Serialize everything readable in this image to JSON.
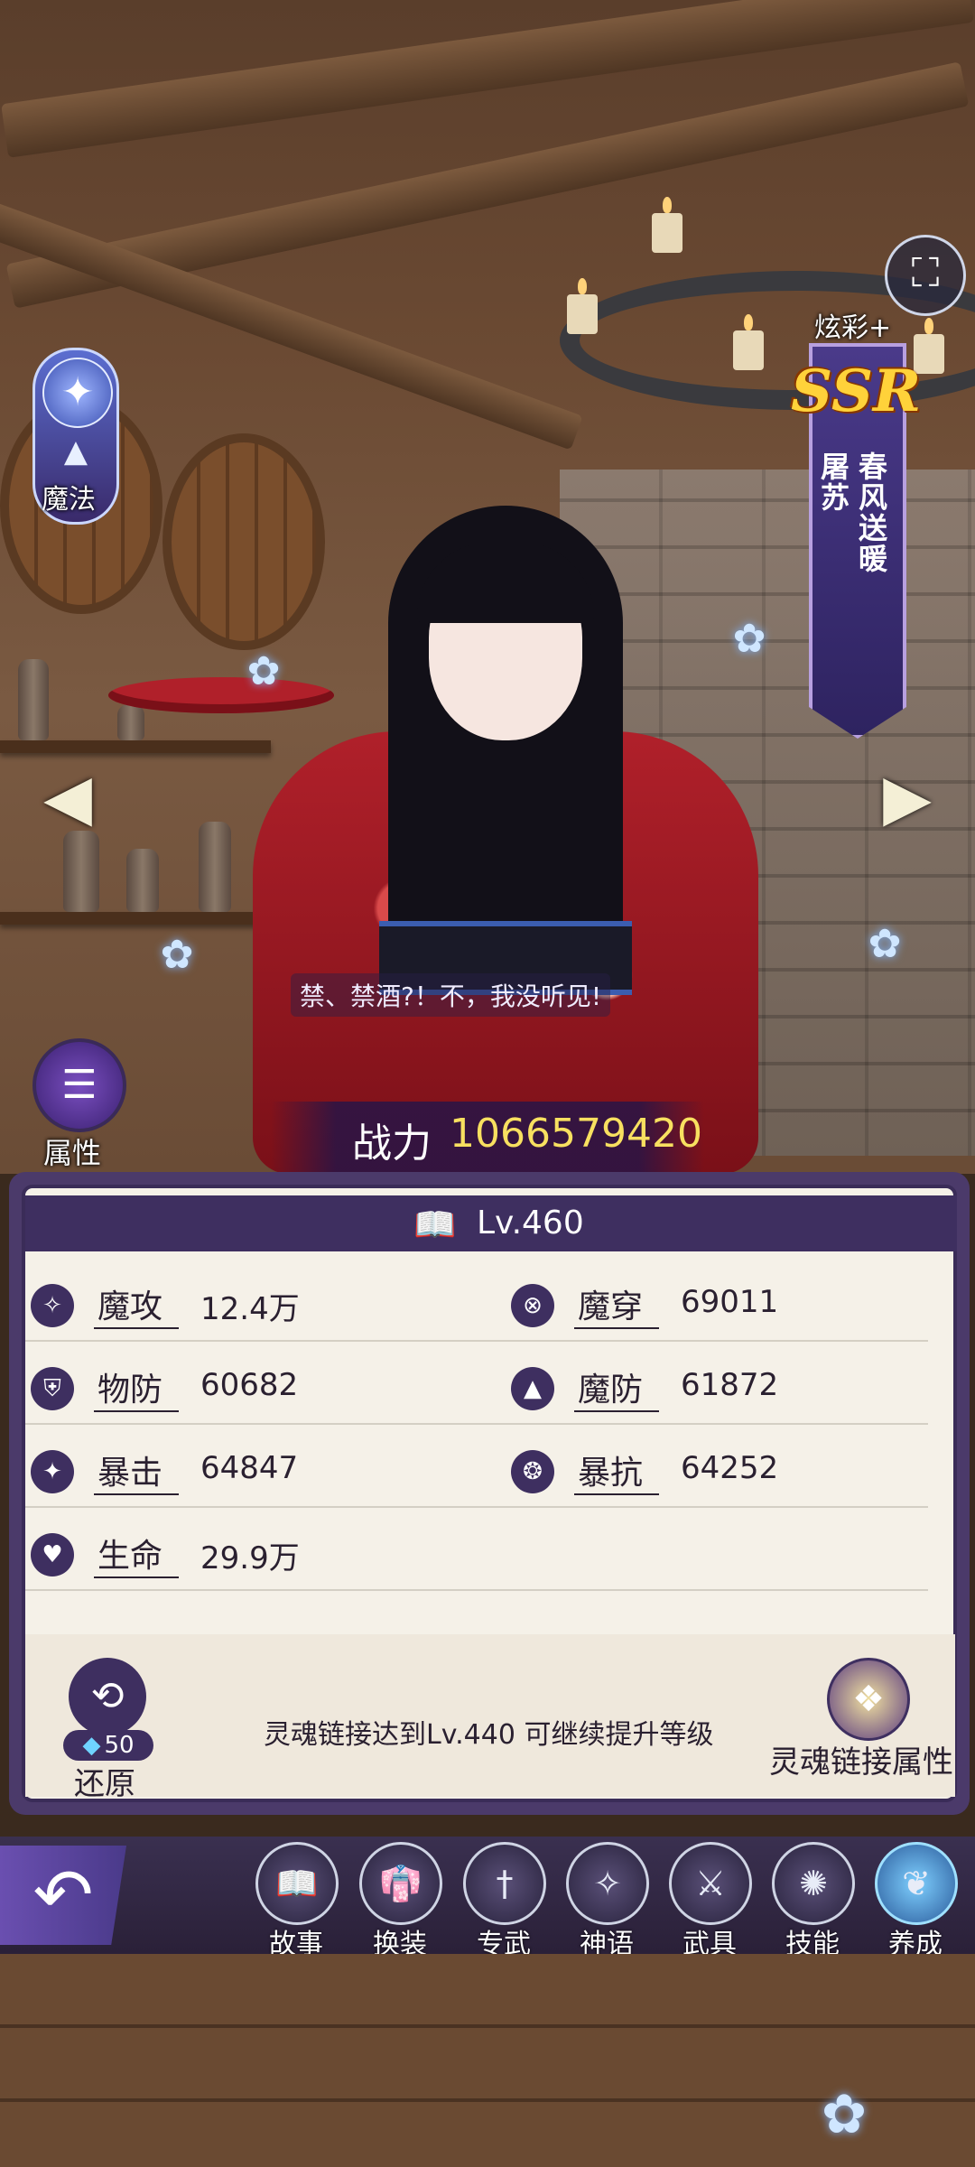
{
  "element": {
    "icon": "wing-crest-icon",
    "type_icon": "magic-hat-icon",
    "label": "魔法"
  },
  "attributes_button": {
    "icon": "list-icon",
    "label": "属性"
  },
  "skin_label": "炫彩+",
  "rarity": "SSR",
  "skin_name": "春风送暖",
  "char_name": "屠苏",
  "dialogue": "禁、禁酒?！不，我没听见!",
  "power": {
    "label": "战力",
    "value": "1066579420"
  },
  "level": {
    "icon": "book-icon",
    "text": "Lv.460"
  },
  "stats": [
    {
      "icon": "magic-attack-icon",
      "name": "魔攻",
      "value": "12.4万"
    },
    {
      "icon": "magic-pierce-icon",
      "name": "魔穿",
      "value": "69011"
    },
    {
      "icon": "physical-defense-icon",
      "name": "物防",
      "value": "60682"
    },
    {
      "icon": "magic-defense-icon",
      "name": "魔防",
      "value": "61872"
    },
    {
      "icon": "critical-icon",
      "name": "暴击",
      "value": "64847"
    },
    {
      "icon": "crit-resist-icon",
      "name": "暴抗",
      "value": "64252"
    },
    {
      "icon": "heart-icon",
      "name": "生命",
      "value": "29.9万"
    }
  ],
  "restore": {
    "icon": "restore-icon",
    "cost": "50",
    "label": "还原"
  },
  "soul_link": {
    "message": "灵魂链接达到Lv.440 可继续提升等级",
    "label": "灵魂链接属性",
    "icon": "soul-link-icon"
  },
  "nav": [
    {
      "label": "故事",
      "icon": "story-book-icon"
    },
    {
      "label": "换装",
      "icon": "outfit-icon"
    },
    {
      "label": "专武",
      "icon": "exclusive-weapon-icon"
    },
    {
      "label": "神语",
      "icon": "divine-speech-icon"
    },
    {
      "label": "武具",
      "icon": "equipment-icon"
    },
    {
      "label": "技能",
      "icon": "skill-icon"
    },
    {
      "label": "养成",
      "icon": "cultivate-icon"
    }
  ],
  "active_nav": "养成"
}
